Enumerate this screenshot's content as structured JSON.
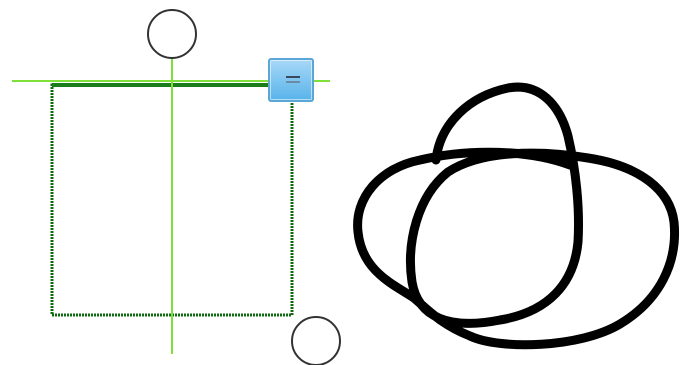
{
  "canvas": {
    "background": "#ffffff"
  },
  "selection": {
    "shape": "rectangle",
    "border_color": "#0f6b0f",
    "top_edge_color": "#1a7d1a",
    "guide_color": "#7fe03a"
  },
  "handles": {
    "rotate_handle_icon": "circle-handle-icon",
    "resize_handle_icon": "circle-handle-icon",
    "move_handle_icon": "move-handle-icon",
    "move_handle_color": "#58b3ea"
  },
  "ink_stroke": {
    "color": "#000000",
    "icon": "freehand-ink-stroke"
  }
}
